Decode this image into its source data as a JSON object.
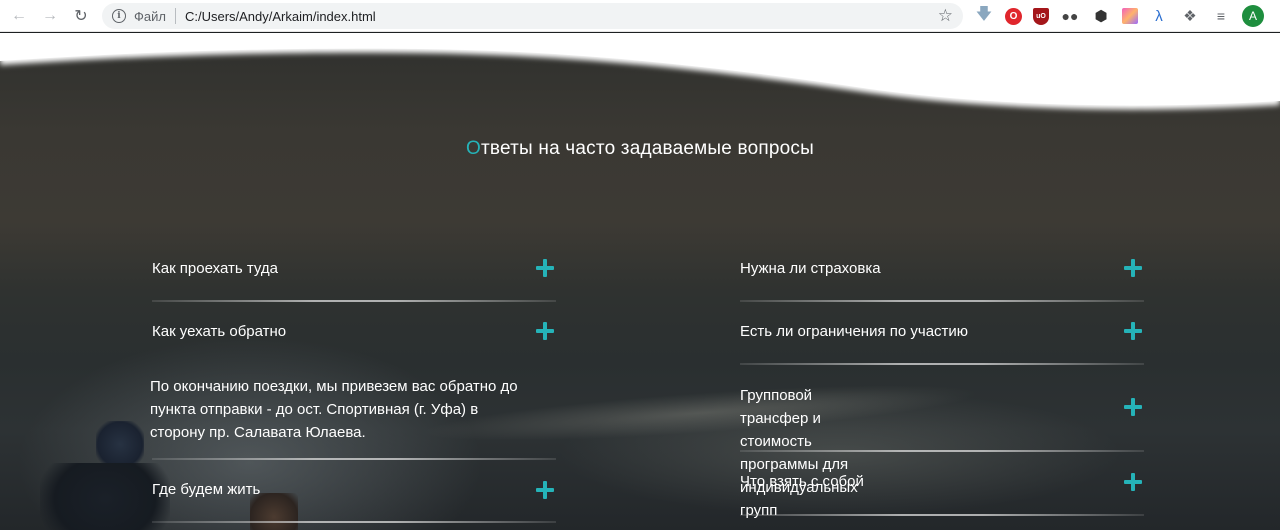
{
  "browser": {
    "scheme_label": "Файл",
    "url": "C:/Users/Andy/Arkaim/index.html",
    "profile_initial": "A",
    "ublock_label": "uO"
  },
  "faq": {
    "title_accent": "О",
    "title_rest": "тветы на часто задаваемые вопросы",
    "left": [
      {
        "question": "Как проехать туда"
      },
      {
        "question": "Как уехать обратно"
      },
      {
        "question": "Где будем жить"
      }
    ],
    "left_answer_lines": [
      "По окончанию поездки, мы привезем вас обратно до",
      "пункта отправки - до ост. Спортивная (г. Уфа) в",
      "сторону пр. Салавата Юлаева."
    ],
    "right": [
      {
        "question": "Нужна ли страховка"
      },
      {
        "question": "Есть ли ограничения по участию"
      },
      {
        "question_lines": [
          "Групповой трансфер и стоимость",
          "программы для индивидуальных групп"
        ]
      },
      {
        "question": "Что взять с собой"
      }
    ]
  },
  "colors": {
    "accent": "#25b3b8",
    "text": "#ffffff"
  }
}
